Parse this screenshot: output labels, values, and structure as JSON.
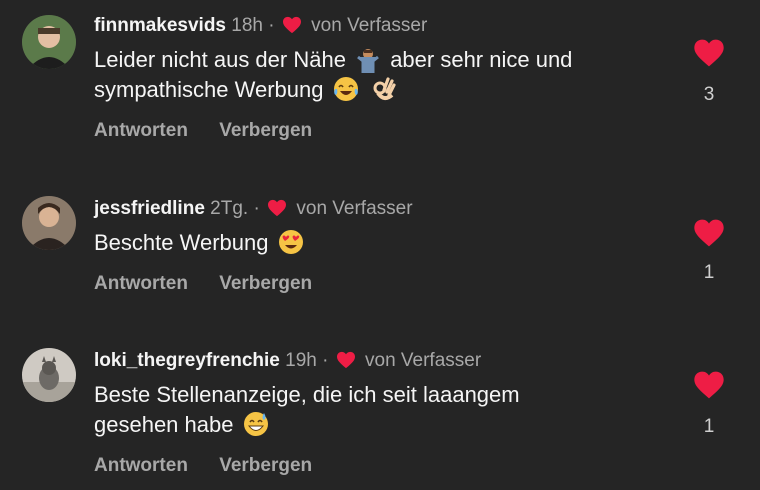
{
  "colors": {
    "background": "#252525",
    "heart": "#ee1d45",
    "muted": "#a8a8a8"
  },
  "comments": [
    {
      "username": "finnmakesvids",
      "time": "18h",
      "liked_by_author_label": "von Verfasser",
      "text_line1": "Leider nicht aus der Nähe",
      "text_line1_after": "aber sehr nice und",
      "text_line2": "sympathische Werbung",
      "emojis": [
        "person-shrugging-emoji",
        "tears-of-joy-emoji",
        "ok-hand-emoji"
      ],
      "reply_label": "Antworten",
      "hide_label": "Verbergen",
      "like_count": "3"
    },
    {
      "username": "jessfriedline",
      "time": "2Tg.",
      "liked_by_author_label": "von Verfasser",
      "text_line1": "Beschte Werbung",
      "emojis": [
        "heart-eyes-emoji"
      ],
      "reply_label": "Antworten",
      "hide_label": "Verbergen",
      "like_count": "1"
    },
    {
      "username": "loki_thegreyfrenchie",
      "time": "19h",
      "liked_by_author_label": "von Verfasser",
      "text_line1": "Beste Stellenanzeige, die ich seit laaangem",
      "text_line2": "gesehen habe",
      "emojis": [
        "grinning-sweat-emoji"
      ],
      "reply_label": "Antworten",
      "hide_label": "Verbergen",
      "like_count": "1"
    }
  ],
  "separator": "·"
}
